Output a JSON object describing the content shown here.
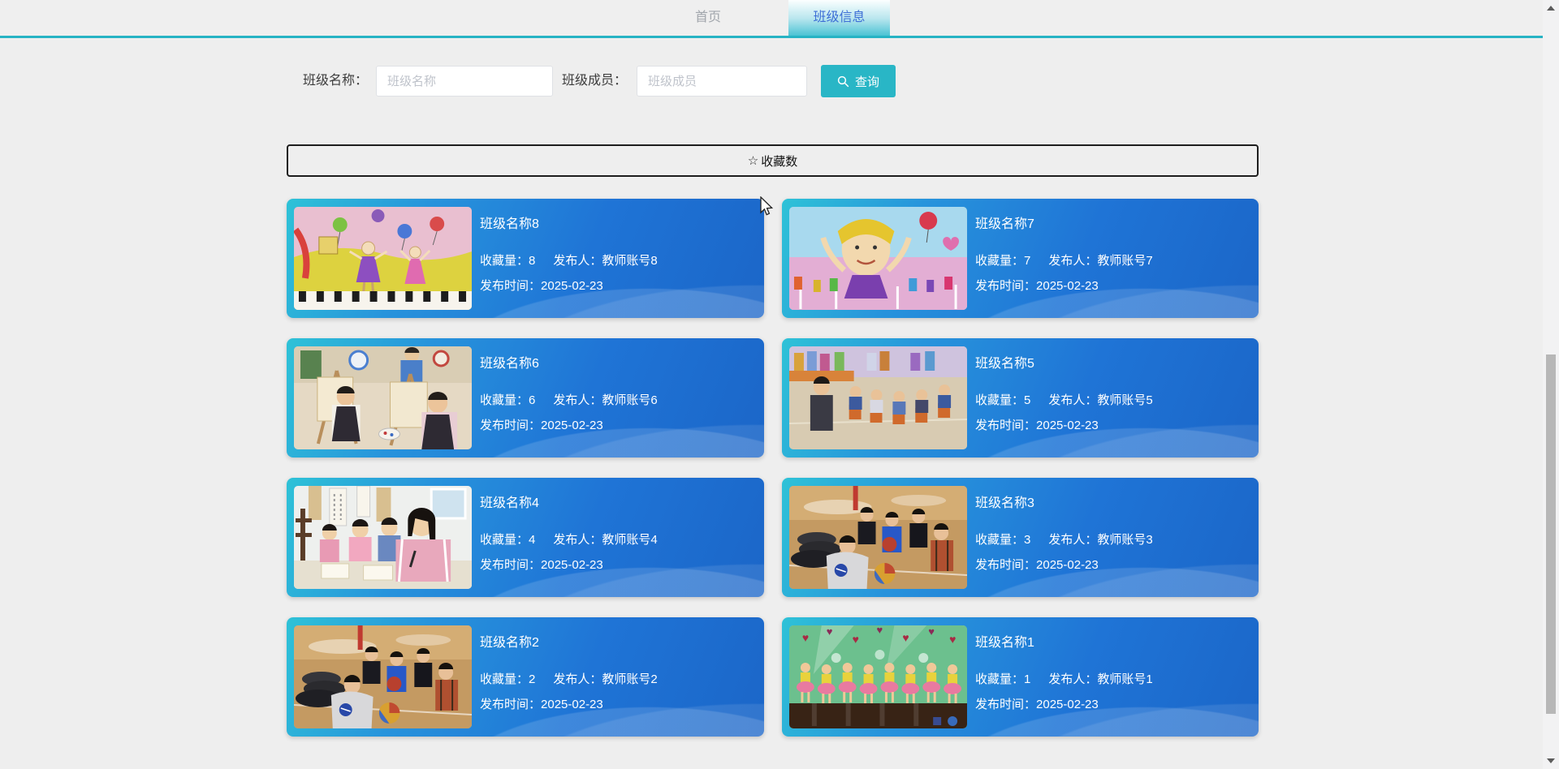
{
  "nav": {
    "tabs": [
      {
        "label": "首页",
        "active": false
      },
      {
        "label": "班级信息",
        "active": true
      }
    ]
  },
  "search": {
    "name_label": "班级名称：",
    "name_placeholder": "班级名称",
    "member_label": "班级成员：",
    "member_placeholder": "班级成员",
    "button_label": "查询"
  },
  "sort": {
    "icon_glyph": "☆",
    "label": "收藏数"
  },
  "card_labels": {
    "favorites": "收藏量：",
    "publisher": "发布人：",
    "publish_time": "发布时间："
  },
  "cards": [
    {
      "title": "班级名称8",
      "favorites": "8",
      "publisher": "教师账号8",
      "publish_time": "2025-02-23",
      "scene": "drawing-piano-dancers"
    },
    {
      "title": "班级名称7",
      "favorites": "7",
      "publisher": "教师账号7",
      "publish_time": "2025-02-23",
      "scene": "drawing-girl-balloons"
    },
    {
      "title": "班级名称6",
      "favorites": "6",
      "publisher": "教师账号6",
      "publish_time": "2025-02-23",
      "scene": "art-studio"
    },
    {
      "title": "班级名称5",
      "favorites": "5",
      "publisher": "教师账号5",
      "publish_time": "2025-02-23",
      "scene": "classroom-circle"
    },
    {
      "title": "班级名称4",
      "favorites": "4",
      "publisher": "教师账号4",
      "publish_time": "2025-02-23",
      "scene": "calligraphy-class"
    },
    {
      "title": "班级名称3",
      "favorites": "3",
      "publisher": "教师账号3",
      "publish_time": "2025-02-23",
      "scene": "gym-basketball"
    },
    {
      "title": "班级名称2",
      "favorites": "2",
      "publisher": "教师账号2",
      "publish_time": "2025-02-23",
      "scene": "gym-basketball"
    },
    {
      "title": "班级名称1",
      "favorites": "1",
      "publisher": "教师账号1",
      "publish_time": "2025-02-23",
      "scene": "stage-dance"
    }
  ],
  "colors": {
    "accent_teal": "#29b6c6",
    "tab_active_text": "#3e6fd6",
    "card_gradient_start": "#2ec2d7",
    "card_gradient_end": "#1b66c8"
  }
}
